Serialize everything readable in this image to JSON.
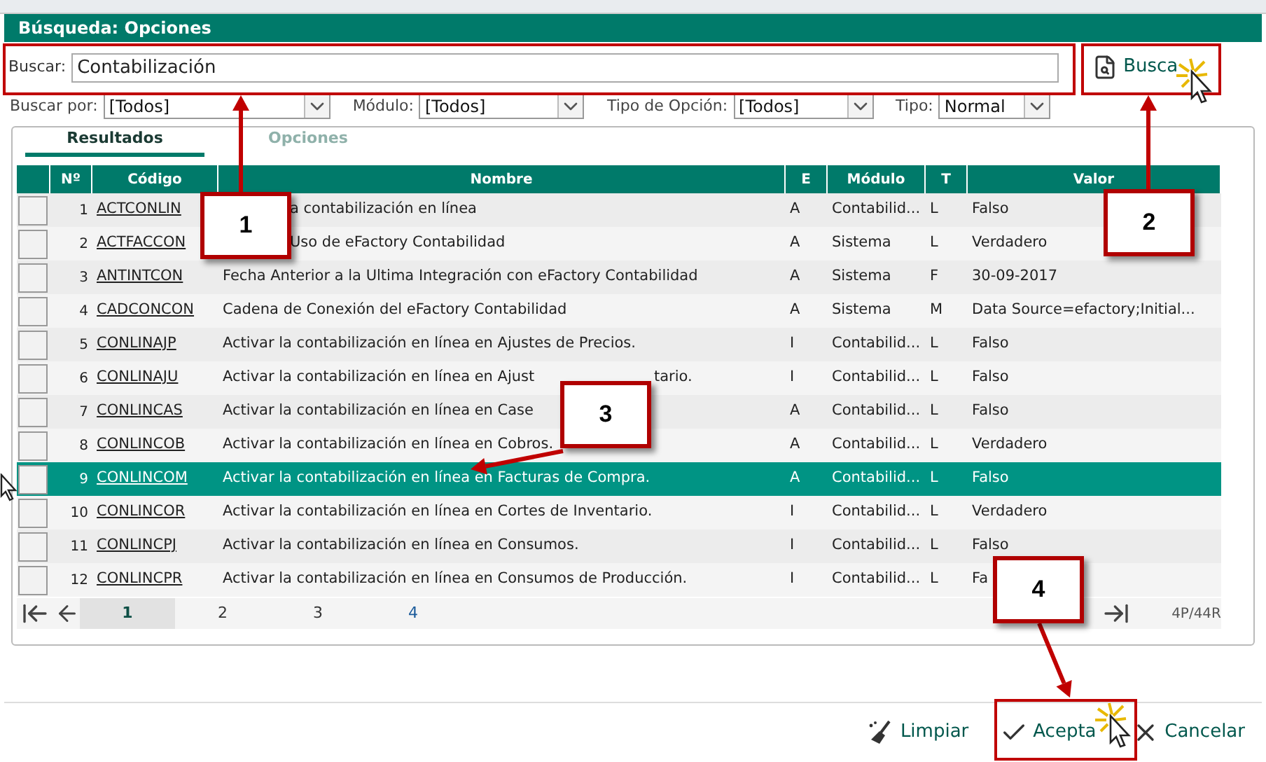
{
  "window": {
    "title": "Búsqueda: Opciones"
  },
  "search": {
    "label": "Buscar:",
    "value": "Contabilización",
    "button": "Busca"
  },
  "filters": [
    {
      "label": "Buscar por:",
      "value": "[Todos]"
    },
    {
      "label": "Módulo:",
      "value": "[Todos]"
    },
    {
      "label": "Tipo de Opción:",
      "value": "[Todos]"
    },
    {
      "label": "Tipo:",
      "value": "Normal"
    }
  ],
  "tabs": [
    {
      "label": "Resultados",
      "selected": true
    },
    {
      "label": "Opciones",
      "selected": false
    }
  ],
  "table": {
    "columns": [
      "Nº",
      "Código",
      "Nombre",
      "E",
      "Módulo",
      "T",
      "Valor"
    ],
    "rows": [
      {
        "selected": false,
        "cells": [
          "1",
          "ACTCONLIN",
          "a contabilización en línea",
          "A",
          "Contabilid...",
          "L",
          "Falso"
        ]
      },
      {
        "selected": false,
        "cells": [
          "2",
          "ACTFACCON",
          "Uso de eFactory Contabilidad",
          "A",
          "Sistema",
          "L",
          "Verdadero"
        ]
      },
      {
        "selected": false,
        "cells": [
          "3",
          "ANTINTCON",
          "Fecha Anterior a la Ultima Integración con eFactory Contabilidad",
          "A",
          "Sistema",
          "F",
          "30-09-2017"
        ]
      },
      {
        "selected": false,
        "cells": [
          "4",
          "CADCONCON",
          "Cadena de Conexión del eFactory Contabilidad",
          "A",
          "Sistema",
          "M",
          "Data Source=efactory;Initial..."
        ]
      },
      {
        "selected": false,
        "cells": [
          "5",
          "CONLINAJP",
          "Activar la contabilización en línea en Ajustes de Precios.",
          "I",
          "Contabilid...",
          "L",
          "Falso"
        ]
      },
      {
        "selected": false,
        "cells": [
          "6",
          "CONLINAJU",
          "Activar la contabilización en línea en Ajust",
          "I",
          "Contabilid...",
          "L",
          "Falso"
        ],
        "name_end": "tario."
      },
      {
        "selected": false,
        "cells": [
          "7",
          "CONLINCAS",
          "Activar la contabilización en línea en Case",
          "A",
          "Contabilid...",
          "L",
          "Falso"
        ]
      },
      {
        "selected": false,
        "cells": [
          "8",
          "CONLINCOB",
          "Activar la contabilización en línea en Cobros.",
          "A",
          "Contabilid...",
          "L",
          "Verdadero"
        ]
      },
      {
        "selected": true,
        "cells": [
          "9",
          "CONLINCOM",
          "Activar la contabilización en línea en Facturas de Compra.",
          "A",
          "Contabilid...",
          "L",
          "Falso"
        ]
      },
      {
        "selected": false,
        "cells": [
          "10",
          "CONLINCOR",
          "Activar la contabilización en línea en Cortes de Inventario.",
          "I",
          "Contabilid...",
          "L",
          "Verdadero"
        ]
      },
      {
        "selected": false,
        "cells": [
          "11",
          "CONLINCPJ",
          "Activar la contabilización en línea en Consumos.",
          "I",
          "Contabilid...",
          "L",
          "Falso"
        ]
      },
      {
        "selected": false,
        "cells": [
          "12",
          "CONLINCPR",
          "Activar la contabilización en línea en Consumos de Producción.",
          "I",
          "Contabilid...",
          "L",
          "Fa"
        ]
      }
    ]
  },
  "pagination": {
    "pages": [
      {
        "label": "1",
        "selected": true
      },
      {
        "label": "2",
        "selected": false
      },
      {
        "label": "3",
        "selected": false
      },
      {
        "label": "4",
        "selected": false
      }
    ],
    "summary": "4P/44R"
  },
  "buttons": [
    {
      "kind": "clear",
      "label": "Limpiar"
    },
    {
      "kind": "accept",
      "label": "Acepta"
    },
    {
      "kind": "cancel",
      "label": "Cancelar"
    }
  ],
  "callouts": [
    "1",
    "2",
    "3",
    "4"
  ]
}
